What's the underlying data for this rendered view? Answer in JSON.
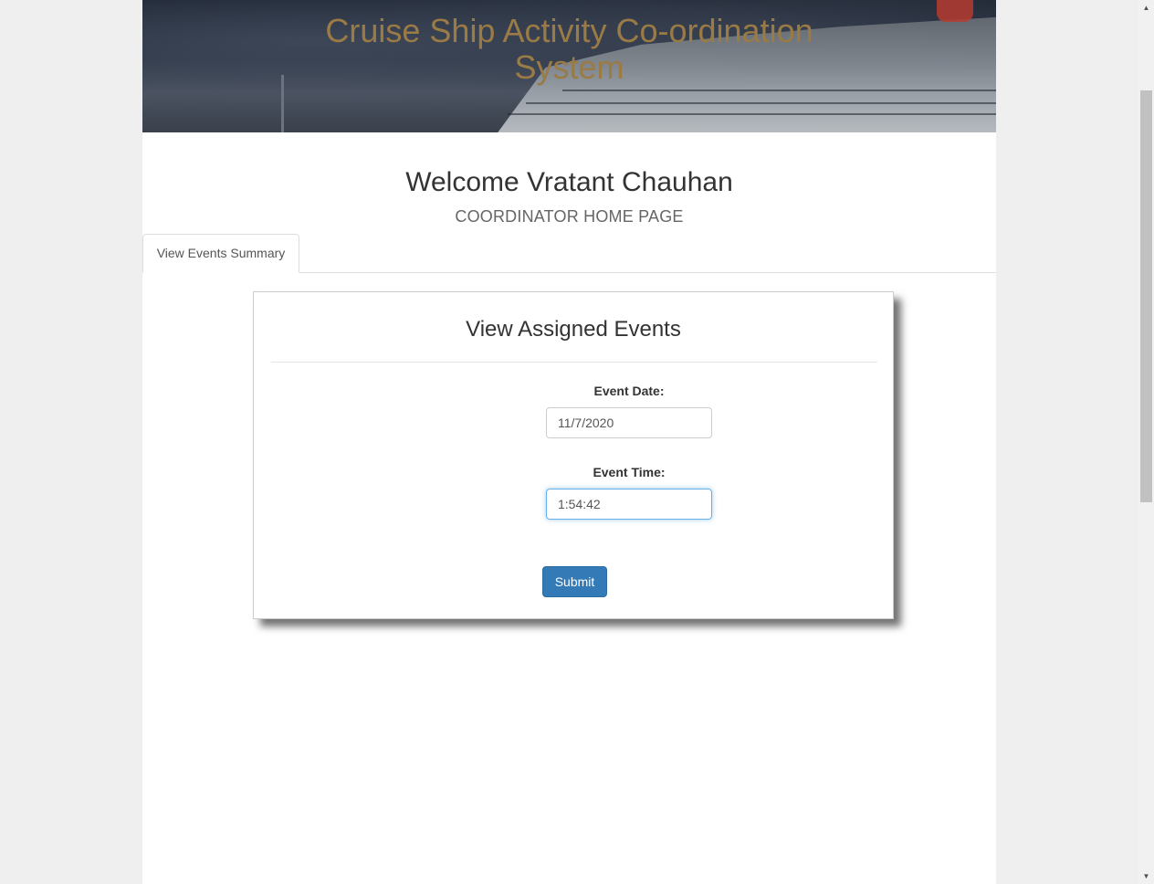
{
  "banner": {
    "title": "Cruise Ship Activity Co-ordination System"
  },
  "header": {
    "welcome": "Welcome Vratant Chauhan",
    "subtitle": "COORDINATOR HOME PAGE"
  },
  "tabs": [
    {
      "label": "View Events Summary",
      "active": true
    }
  ],
  "form": {
    "title": "View Assigned Events",
    "event_date": {
      "label": "Event Date:",
      "value": "11/7/2020"
    },
    "event_time": {
      "label": "Event Time:",
      "value": "1:54:42"
    },
    "submit_label": "Submit"
  },
  "colors": {
    "banner_title": "#9a7a45",
    "primary_button": "#337ab7",
    "focus_border": "#66afe9"
  },
  "icons": {
    "scroll_up": "scroll-up-arrow-icon",
    "scroll_down": "scroll-down-arrow-icon"
  }
}
